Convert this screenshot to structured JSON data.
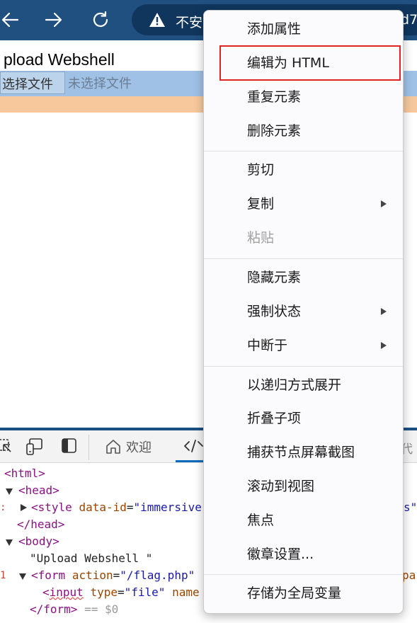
{
  "browser": {
    "address_text": "不安",
    "address_tail": "d7",
    "colors": {
      "toolbar": "#20507f",
      "address_bar": "#10365e"
    },
    "icons": [
      "back-arrow-icon",
      "forward-arrow-icon",
      "refresh-icon",
      "warning-icon"
    ]
  },
  "page": {
    "heading": "pload Webshell",
    "file_button": "选择文件",
    "file_status": "未选择文件"
  },
  "devtools": {
    "tab_welcome": "欢迎",
    "tab_right_partial": "代",
    "accent_color": "#0f6cbd",
    "dom": {
      "html_open": "<html>",
      "head_open": "<head>",
      "style_tag": "<style",
      "style_attr": "data-id",
      "style_eq": "=",
      "style_val": "\"immersive",
      "style_tail": "s\"",
      "head_close": "</head>",
      "body_open": "<body>",
      "text_node": "\"Upload Webshell \"",
      "form_tag": "<form",
      "form_attr": "action",
      "form_eq": "=",
      "form_val": "\"/flag.php\"",
      "form_tail": "pa",
      "input_lt": "<",
      "input_tag": "input",
      "input_attr": "type",
      "input_eq": "=",
      "input_val": "\"file\"",
      "input_name": "name",
      "form_close": "</form>",
      "selected_suffix": "== $0",
      "gutter_colon": ":",
      "gutter_mark": "1"
    }
  },
  "context_menu": {
    "items": [
      {
        "label": "添加属性"
      },
      {
        "label": "编辑为 HTML",
        "highlighted": true
      },
      {
        "label": "重复元素"
      },
      {
        "label": "删除元素"
      },
      {
        "label": "剪切"
      },
      {
        "label": "复制",
        "submenu": true
      },
      {
        "label": "粘贴",
        "disabled": true
      },
      {
        "label": "隐藏元素"
      },
      {
        "label": "强制状态",
        "submenu": true
      },
      {
        "label": "中断于",
        "submenu": true
      },
      {
        "label": "以递归方式展开"
      },
      {
        "label": "折叠子项"
      },
      {
        "label": "捕获节点屏幕截图"
      },
      {
        "label": "滚动到视图"
      },
      {
        "label": "焦点"
      },
      {
        "label": "徽章设置..."
      },
      {
        "label": "存储为全局变量"
      }
    ],
    "highlight_color": "#e02424"
  }
}
